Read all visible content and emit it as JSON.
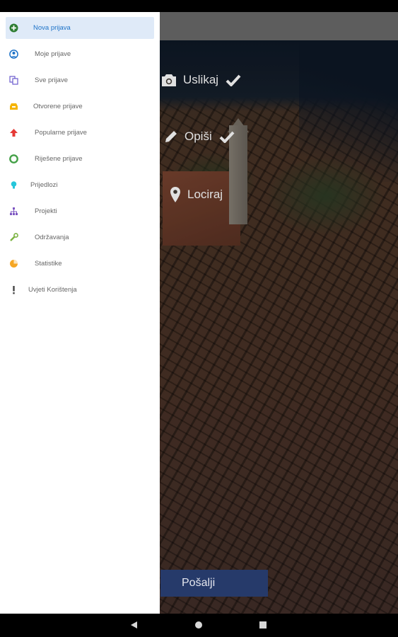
{
  "drawer": {
    "items": [
      {
        "label": "Nova prijava",
        "icon": "add-circle-icon",
        "color": "#2e7d32",
        "active": true
      },
      {
        "label": "Moje prijave",
        "icon": "user-circle-icon",
        "color": "#1e73c8",
        "active": false
      },
      {
        "label": "Sve prijave",
        "icon": "copy-documents-icon",
        "color": "#6a5acd",
        "active": false
      },
      {
        "label": "Otvorene prijave",
        "icon": "inbox-tray-icon",
        "color": "#f5b400",
        "active": false
      },
      {
        "label": "Popularne prijave",
        "icon": "arrow-up-icon",
        "color": "#e53935",
        "active": false
      },
      {
        "label": "Riješene prijave",
        "icon": "lifebuoy-icon",
        "color": "#43a047",
        "active": false
      },
      {
        "label": "Prijedlozi",
        "icon": "lightbulb-icon",
        "color": "#26c6da",
        "active": false
      },
      {
        "label": "Projekti",
        "icon": "sitemap-icon",
        "color": "#7e57c2",
        "active": false
      },
      {
        "label": "Održavanja",
        "icon": "wrench-icon",
        "color": "#7cb342",
        "active": false
      },
      {
        "label": "Statistike",
        "icon": "pie-chart-icon",
        "color": "#f5a623",
        "active": false
      },
      {
        "label": "Uvjeti Korištenja",
        "icon": "exclamation-icon",
        "color": "#444444",
        "active": false
      }
    ]
  },
  "steps": {
    "uslikaj": "Uslikaj",
    "opisi": "Opiši",
    "lociraj": "Lociraj"
  },
  "send_label": "Pošalji"
}
